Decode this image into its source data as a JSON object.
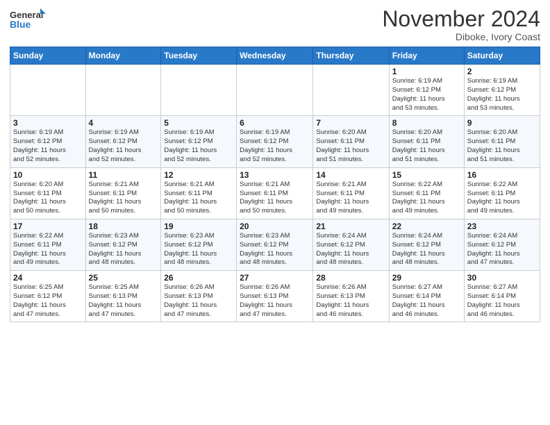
{
  "header": {
    "logo_general": "General",
    "logo_blue": "Blue",
    "month_title": "November 2024",
    "location": "Diboke, Ivory Coast"
  },
  "weekdays": [
    "Sunday",
    "Monday",
    "Tuesday",
    "Wednesday",
    "Thursday",
    "Friday",
    "Saturday"
  ],
  "weeks": [
    [
      {
        "day": "",
        "info": ""
      },
      {
        "day": "",
        "info": ""
      },
      {
        "day": "",
        "info": ""
      },
      {
        "day": "",
        "info": ""
      },
      {
        "day": "",
        "info": ""
      },
      {
        "day": "1",
        "info": "Sunrise: 6:19 AM\nSunset: 6:12 PM\nDaylight: 11 hours\nand 53 minutes."
      },
      {
        "day": "2",
        "info": "Sunrise: 6:19 AM\nSunset: 6:12 PM\nDaylight: 11 hours\nand 53 minutes."
      }
    ],
    [
      {
        "day": "3",
        "info": "Sunrise: 6:19 AM\nSunset: 6:12 PM\nDaylight: 11 hours\nand 52 minutes."
      },
      {
        "day": "4",
        "info": "Sunrise: 6:19 AM\nSunset: 6:12 PM\nDaylight: 11 hours\nand 52 minutes."
      },
      {
        "day": "5",
        "info": "Sunrise: 6:19 AM\nSunset: 6:12 PM\nDaylight: 11 hours\nand 52 minutes."
      },
      {
        "day": "6",
        "info": "Sunrise: 6:19 AM\nSunset: 6:12 PM\nDaylight: 11 hours\nand 52 minutes."
      },
      {
        "day": "7",
        "info": "Sunrise: 6:20 AM\nSunset: 6:11 PM\nDaylight: 11 hours\nand 51 minutes."
      },
      {
        "day": "8",
        "info": "Sunrise: 6:20 AM\nSunset: 6:11 PM\nDaylight: 11 hours\nand 51 minutes."
      },
      {
        "day": "9",
        "info": "Sunrise: 6:20 AM\nSunset: 6:11 PM\nDaylight: 11 hours\nand 51 minutes."
      }
    ],
    [
      {
        "day": "10",
        "info": "Sunrise: 6:20 AM\nSunset: 6:11 PM\nDaylight: 11 hours\nand 50 minutes."
      },
      {
        "day": "11",
        "info": "Sunrise: 6:21 AM\nSunset: 6:11 PM\nDaylight: 11 hours\nand 50 minutes."
      },
      {
        "day": "12",
        "info": "Sunrise: 6:21 AM\nSunset: 6:11 PM\nDaylight: 11 hours\nand 50 minutes."
      },
      {
        "day": "13",
        "info": "Sunrise: 6:21 AM\nSunset: 6:11 PM\nDaylight: 11 hours\nand 50 minutes."
      },
      {
        "day": "14",
        "info": "Sunrise: 6:21 AM\nSunset: 6:11 PM\nDaylight: 11 hours\nand 49 minutes."
      },
      {
        "day": "15",
        "info": "Sunrise: 6:22 AM\nSunset: 6:11 PM\nDaylight: 11 hours\nand 49 minutes."
      },
      {
        "day": "16",
        "info": "Sunrise: 6:22 AM\nSunset: 6:11 PM\nDaylight: 11 hours\nand 49 minutes."
      }
    ],
    [
      {
        "day": "17",
        "info": "Sunrise: 6:22 AM\nSunset: 6:11 PM\nDaylight: 11 hours\nand 49 minutes."
      },
      {
        "day": "18",
        "info": "Sunrise: 6:23 AM\nSunset: 6:12 PM\nDaylight: 11 hours\nand 48 minutes."
      },
      {
        "day": "19",
        "info": "Sunrise: 6:23 AM\nSunset: 6:12 PM\nDaylight: 11 hours\nand 48 minutes."
      },
      {
        "day": "20",
        "info": "Sunrise: 6:23 AM\nSunset: 6:12 PM\nDaylight: 11 hours\nand 48 minutes."
      },
      {
        "day": "21",
        "info": "Sunrise: 6:24 AM\nSunset: 6:12 PM\nDaylight: 11 hours\nand 48 minutes."
      },
      {
        "day": "22",
        "info": "Sunrise: 6:24 AM\nSunset: 6:12 PM\nDaylight: 11 hours\nand 48 minutes."
      },
      {
        "day": "23",
        "info": "Sunrise: 6:24 AM\nSunset: 6:12 PM\nDaylight: 11 hours\nand 47 minutes."
      }
    ],
    [
      {
        "day": "24",
        "info": "Sunrise: 6:25 AM\nSunset: 6:12 PM\nDaylight: 11 hours\nand 47 minutes."
      },
      {
        "day": "25",
        "info": "Sunrise: 6:25 AM\nSunset: 6:13 PM\nDaylight: 11 hours\nand 47 minutes."
      },
      {
        "day": "26",
        "info": "Sunrise: 6:26 AM\nSunset: 6:13 PM\nDaylight: 11 hours\nand 47 minutes."
      },
      {
        "day": "27",
        "info": "Sunrise: 6:26 AM\nSunset: 6:13 PM\nDaylight: 11 hours\nand 47 minutes."
      },
      {
        "day": "28",
        "info": "Sunrise: 6:26 AM\nSunset: 6:13 PM\nDaylight: 11 hours\nand 46 minutes."
      },
      {
        "day": "29",
        "info": "Sunrise: 6:27 AM\nSunset: 6:14 PM\nDaylight: 11 hours\nand 46 minutes."
      },
      {
        "day": "30",
        "info": "Sunrise: 6:27 AM\nSunset: 6:14 PM\nDaylight: 11 hours\nand 46 minutes."
      }
    ]
  ]
}
